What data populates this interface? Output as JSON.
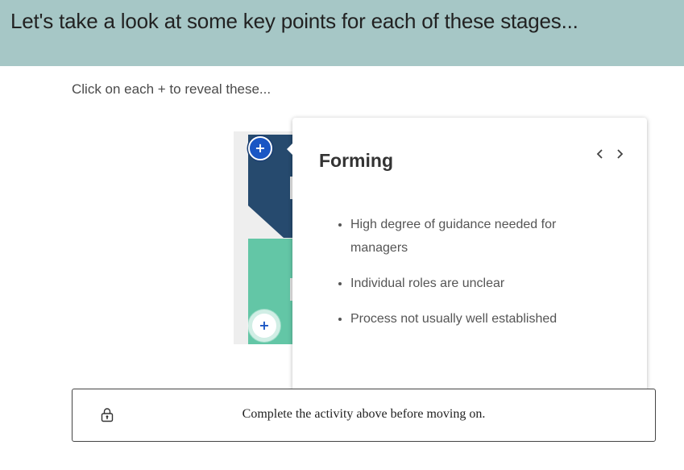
{
  "header": {
    "title": "Let's take a look at some key points for each of these stages..."
  },
  "instructions": "Click on each + to reveal these...",
  "markers": [
    {
      "label": "+",
      "state": "active"
    },
    {
      "label": "+",
      "state": "inactive"
    }
  ],
  "popover": {
    "title": "Forming",
    "prev_icon": "chevron-left-icon",
    "next_icon": "chevron-right-icon",
    "points": [
      "High degree of guidance needed for managers",
      "Individual roles are unclear",
      "Process not usually well established"
    ]
  },
  "lock_bar": {
    "icon": "lock-icon",
    "text": "Complete the activity above before moving on."
  },
  "colors": {
    "header_bg": "#a6c7c6",
    "navy": "#264a6e",
    "teal": "#63c6a6",
    "accent_blue": "#1b5fc1"
  }
}
